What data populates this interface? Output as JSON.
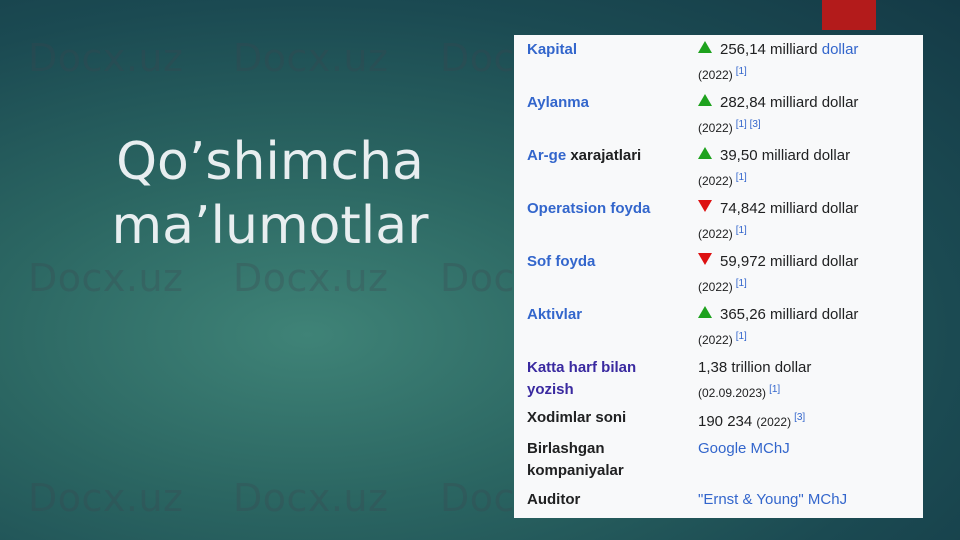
{
  "slide": {
    "title_line1": "Qo’shimcha",
    "title_line2": "ma’lumotlar"
  },
  "watermark": "Docx.uz",
  "colors": {
    "accent_red": "#b31b1b",
    "link": "#3366cc",
    "up": "#1ea21e",
    "down": "#dd1111"
  },
  "infobox": {
    "rows": [
      {
        "label": "Kapital",
        "trend": "up",
        "value_main": "256,14 milliard",
        "value_link": "dollar",
        "sub_text": "(2022)",
        "refs": "[1]"
      },
      {
        "label": "Aylanma",
        "trend": "up",
        "value_main": "282,84 milliard dollar",
        "sub_text": "(2022)",
        "refs": "[1] [3]"
      },
      {
        "label_link": "Ar-ge",
        "label_rest": "xarajatlari",
        "trend": "up",
        "value_main": "39,50 milliard dollar",
        "sub_text": "(2022)",
        "refs": "[1]"
      },
      {
        "label": "Operatsion foyda",
        "trend": "down",
        "value_main": "74,842 milliard dollar",
        "sub_text": "(2022)",
        "refs": "[1]"
      },
      {
        "label": "Sof foyda",
        "trend": "down",
        "value_main": "59,972 milliard dollar",
        "sub_text": "(2022)",
        "refs": "[1]"
      },
      {
        "label": "Aktivlar",
        "trend": "up",
        "value_main": "365,26 milliard dollar",
        "sub_text": "(2022)",
        "refs": "[1]"
      },
      {
        "label_line1": "Katta harf bilan",
        "label_line2": "yozish",
        "value_main": "1,38 trillion dollar",
        "sub_text": "(02.09.2023)",
        "refs": "[1]"
      },
      {
        "label": "Xodimlar soni",
        "value_main": "190 234",
        "value_inline_sub": "(2022)",
        "refs": "[3]"
      },
      {
        "label_line1": "Birlashgan",
        "label_line2": "kompaniyalar",
        "value_link": "Google MChJ"
      },
      {
        "label": "Auditor",
        "value_link": "\"Ernst & Young\" MChJ"
      }
    ]
  }
}
